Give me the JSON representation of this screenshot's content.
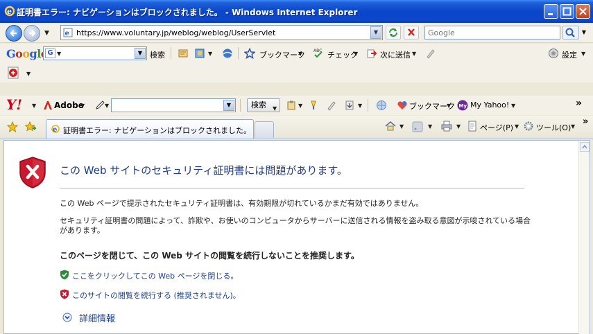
{
  "window": {
    "title": "証明書エラー: ナビゲーションはブロックされました。 - Windows Internet Explorer"
  },
  "address_bar": {
    "url": "https://www.voluntary.jp/weblog/weblog/UserServlet",
    "search_placeholder": "Google"
  },
  "google_toolbar": {
    "search_label": "検索",
    "bookmarks_label": "ブックマーク",
    "check_label": "チェック",
    "send_to_label": "次に送信",
    "settings_label": "設定"
  },
  "yahoo_toolbar": {
    "adobe_label": "Adobe",
    "search_button_label": "検索",
    "bookmarks_label": "ブックマーク",
    "my_yahoo_label": "My Yahoo!",
    "more_label": "»"
  },
  "tab_bar": {
    "active_tab_title": "証明書エラー: ナビゲーションはブロックされました。",
    "page_menu_label": "ページ(P)",
    "tools_menu_label": "ツール(O)",
    "more_label": "»"
  },
  "error_page": {
    "title": "この Web サイトのセキュリティ証明書には問題があります。",
    "message1": "この Web ページで提示されたセキュリティ証明書は、有効期限が切れているかまだ有効ではありません。",
    "message2": "セキュリティ証明書の問題によって、詐欺や、お使いのコンピュータからサーバーに送信される情報を盗み取る意図が示唆されている場合があります。",
    "recommendation": "このページを閉じて、この Web サイトの閲覧を続行しないことを推奨します。",
    "close_link": "ここをクリックしてこの Web ページを閉じる。",
    "continue_link": "このサイトの閲覧を続行する (推奨されません)。",
    "details_link": "詳細情報"
  },
  "colors": {
    "titlebar": "#0a46c9",
    "link": "#1c3f8c",
    "error_shield": "#c8182e",
    "safe_shield": "#2e8b3d"
  }
}
